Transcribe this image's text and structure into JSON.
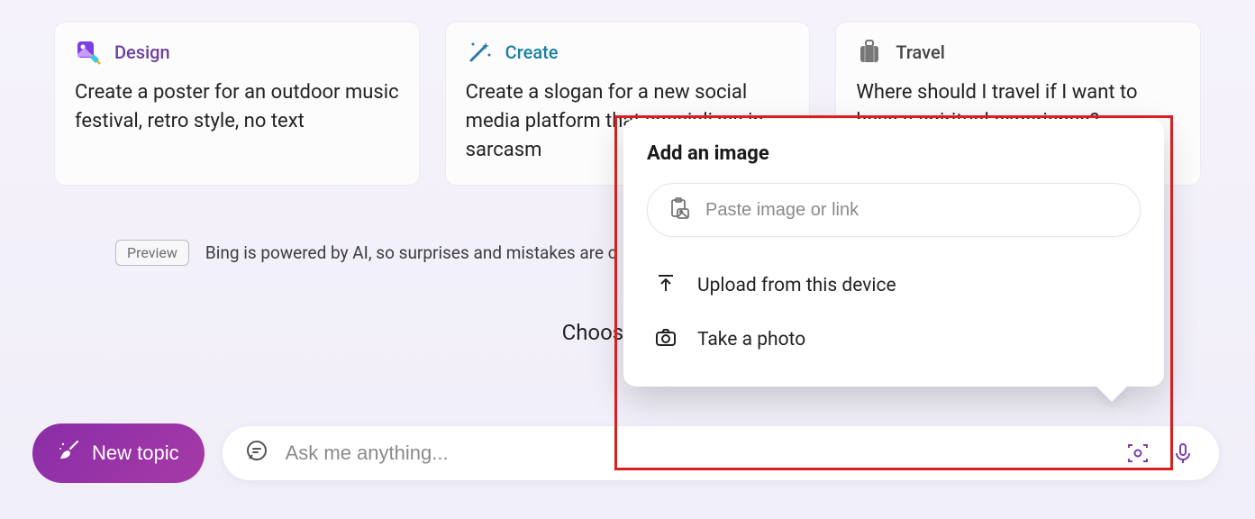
{
  "cards": [
    {
      "title": "Design",
      "body": "Create a poster for an outdoor music festival, retro style, no text"
    },
    {
      "title": "Create",
      "body": "Create a slogan for a new social media platform that specializes in sarcasm"
    },
    {
      "title": "Travel",
      "body": "Where should I travel if I want to have a spiritual experience?"
    }
  ],
  "preview": {
    "badge": "Preview",
    "text": "Bing is powered by AI, so surprises and mistakes are c"
  },
  "choose": "Choose a con",
  "new_topic": "New topic",
  "ask_placeholder": "Ask me anything...",
  "popover": {
    "title": "Add an image",
    "paste_placeholder": "Paste image or link",
    "upload": "Upload from this device",
    "take_photo": "Take a photo"
  }
}
